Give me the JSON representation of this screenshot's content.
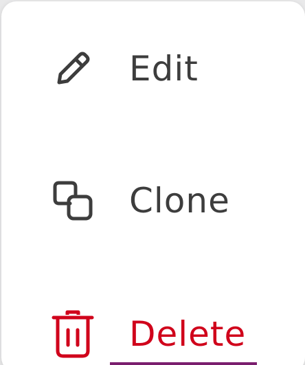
{
  "menu": {
    "items": [
      {
        "label": "Edit",
        "icon": "pencil-icon",
        "color": "#3d3d3d"
      },
      {
        "label": "Clone",
        "icon": "clone-icon",
        "color": "#3d3d3d"
      },
      {
        "label": "Delete",
        "icon": "trash-icon",
        "color": "#d0021b"
      }
    ]
  },
  "colors": {
    "text": "#3d3d3d",
    "danger": "#d0021b",
    "accent": "#7a1e6e"
  }
}
